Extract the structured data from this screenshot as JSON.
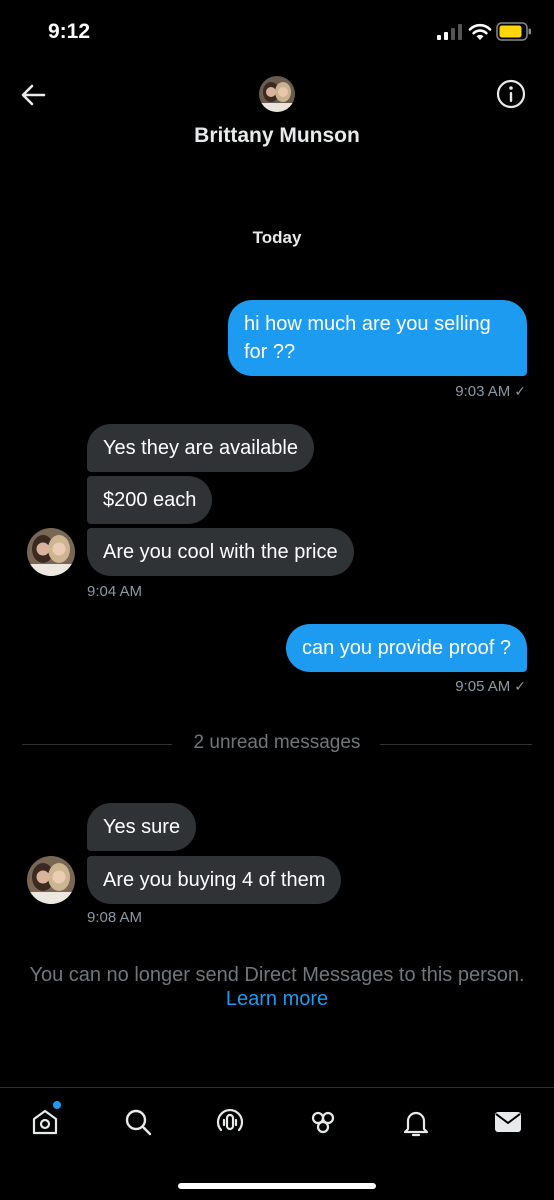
{
  "status_bar": {
    "time": "9:12"
  },
  "header": {
    "name": "Brittany Munson"
  },
  "conversation": {
    "date_label": "Today",
    "msg1": {
      "text": "hi how much are you selling for ??",
      "time": "9:03 AM"
    },
    "group1": {
      "messages": [
        "Yes they are available",
        "$200 each",
        "Are you cool with the price"
      ],
      "time": "9:04 AM"
    },
    "msg2": {
      "text": "can you provide proof ?",
      "time": "9:05 AM"
    },
    "unread_label": "2 unread messages",
    "group2": {
      "messages": [
        "Yes sure",
        "Are you buying 4 of them"
      ],
      "time": "9:08 AM"
    }
  },
  "notice": {
    "text": "You can no longer send Direct Messages to this person.",
    "link": "Learn more"
  },
  "tabs": [
    "home-icon",
    "search-icon",
    "spaces-icon",
    "communities-icon",
    "notifications-icon",
    "messages-icon"
  ],
  "colors": {
    "accent": "#1d9bf0",
    "background": "#000000",
    "received_bubble": "#2f3336",
    "muted": "#71767b"
  }
}
